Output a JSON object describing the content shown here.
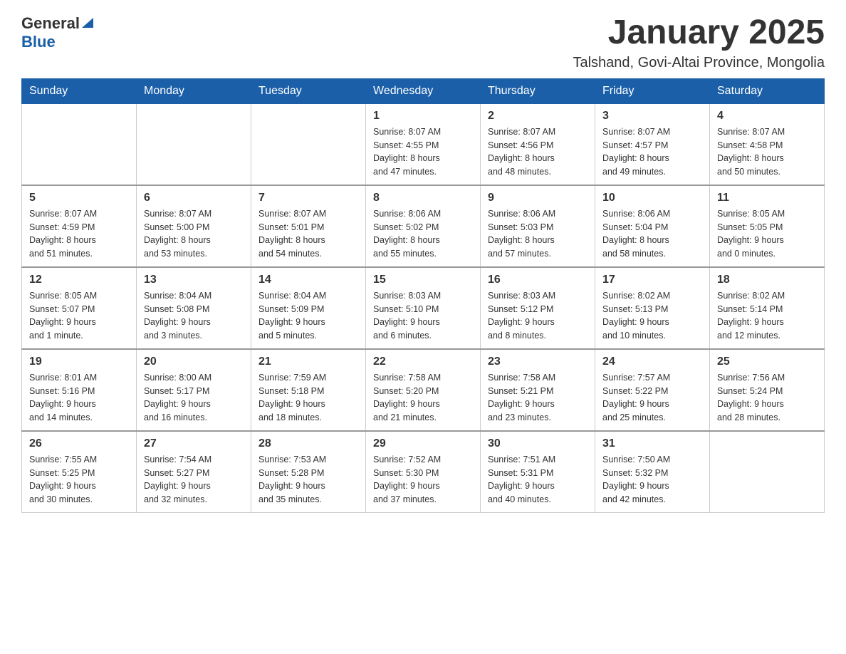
{
  "logo": {
    "general": "General",
    "blue": "Blue"
  },
  "header": {
    "title": "January 2025",
    "subtitle": "Talshand, Govi-Altai Province, Mongolia"
  },
  "days_of_week": [
    "Sunday",
    "Monday",
    "Tuesday",
    "Wednesday",
    "Thursday",
    "Friday",
    "Saturday"
  ],
  "weeks": [
    {
      "days": [
        {
          "num": "",
          "info": ""
        },
        {
          "num": "",
          "info": ""
        },
        {
          "num": "",
          "info": ""
        },
        {
          "num": "1",
          "info": "Sunrise: 8:07 AM\nSunset: 4:55 PM\nDaylight: 8 hours\nand 47 minutes."
        },
        {
          "num": "2",
          "info": "Sunrise: 8:07 AM\nSunset: 4:56 PM\nDaylight: 8 hours\nand 48 minutes."
        },
        {
          "num": "3",
          "info": "Sunrise: 8:07 AM\nSunset: 4:57 PM\nDaylight: 8 hours\nand 49 minutes."
        },
        {
          "num": "4",
          "info": "Sunrise: 8:07 AM\nSunset: 4:58 PM\nDaylight: 8 hours\nand 50 minutes."
        }
      ]
    },
    {
      "days": [
        {
          "num": "5",
          "info": "Sunrise: 8:07 AM\nSunset: 4:59 PM\nDaylight: 8 hours\nand 51 minutes."
        },
        {
          "num": "6",
          "info": "Sunrise: 8:07 AM\nSunset: 5:00 PM\nDaylight: 8 hours\nand 53 minutes."
        },
        {
          "num": "7",
          "info": "Sunrise: 8:07 AM\nSunset: 5:01 PM\nDaylight: 8 hours\nand 54 minutes."
        },
        {
          "num": "8",
          "info": "Sunrise: 8:06 AM\nSunset: 5:02 PM\nDaylight: 8 hours\nand 55 minutes."
        },
        {
          "num": "9",
          "info": "Sunrise: 8:06 AM\nSunset: 5:03 PM\nDaylight: 8 hours\nand 57 minutes."
        },
        {
          "num": "10",
          "info": "Sunrise: 8:06 AM\nSunset: 5:04 PM\nDaylight: 8 hours\nand 58 minutes."
        },
        {
          "num": "11",
          "info": "Sunrise: 8:05 AM\nSunset: 5:05 PM\nDaylight: 9 hours\nand 0 minutes."
        }
      ]
    },
    {
      "days": [
        {
          "num": "12",
          "info": "Sunrise: 8:05 AM\nSunset: 5:07 PM\nDaylight: 9 hours\nand 1 minute."
        },
        {
          "num": "13",
          "info": "Sunrise: 8:04 AM\nSunset: 5:08 PM\nDaylight: 9 hours\nand 3 minutes."
        },
        {
          "num": "14",
          "info": "Sunrise: 8:04 AM\nSunset: 5:09 PM\nDaylight: 9 hours\nand 5 minutes."
        },
        {
          "num": "15",
          "info": "Sunrise: 8:03 AM\nSunset: 5:10 PM\nDaylight: 9 hours\nand 6 minutes."
        },
        {
          "num": "16",
          "info": "Sunrise: 8:03 AM\nSunset: 5:12 PM\nDaylight: 9 hours\nand 8 minutes."
        },
        {
          "num": "17",
          "info": "Sunrise: 8:02 AM\nSunset: 5:13 PM\nDaylight: 9 hours\nand 10 minutes."
        },
        {
          "num": "18",
          "info": "Sunrise: 8:02 AM\nSunset: 5:14 PM\nDaylight: 9 hours\nand 12 minutes."
        }
      ]
    },
    {
      "days": [
        {
          "num": "19",
          "info": "Sunrise: 8:01 AM\nSunset: 5:16 PM\nDaylight: 9 hours\nand 14 minutes."
        },
        {
          "num": "20",
          "info": "Sunrise: 8:00 AM\nSunset: 5:17 PM\nDaylight: 9 hours\nand 16 minutes."
        },
        {
          "num": "21",
          "info": "Sunrise: 7:59 AM\nSunset: 5:18 PM\nDaylight: 9 hours\nand 18 minutes."
        },
        {
          "num": "22",
          "info": "Sunrise: 7:58 AM\nSunset: 5:20 PM\nDaylight: 9 hours\nand 21 minutes."
        },
        {
          "num": "23",
          "info": "Sunrise: 7:58 AM\nSunset: 5:21 PM\nDaylight: 9 hours\nand 23 minutes."
        },
        {
          "num": "24",
          "info": "Sunrise: 7:57 AM\nSunset: 5:22 PM\nDaylight: 9 hours\nand 25 minutes."
        },
        {
          "num": "25",
          "info": "Sunrise: 7:56 AM\nSunset: 5:24 PM\nDaylight: 9 hours\nand 28 minutes."
        }
      ]
    },
    {
      "days": [
        {
          "num": "26",
          "info": "Sunrise: 7:55 AM\nSunset: 5:25 PM\nDaylight: 9 hours\nand 30 minutes."
        },
        {
          "num": "27",
          "info": "Sunrise: 7:54 AM\nSunset: 5:27 PM\nDaylight: 9 hours\nand 32 minutes."
        },
        {
          "num": "28",
          "info": "Sunrise: 7:53 AM\nSunset: 5:28 PM\nDaylight: 9 hours\nand 35 minutes."
        },
        {
          "num": "29",
          "info": "Sunrise: 7:52 AM\nSunset: 5:30 PM\nDaylight: 9 hours\nand 37 minutes."
        },
        {
          "num": "30",
          "info": "Sunrise: 7:51 AM\nSunset: 5:31 PM\nDaylight: 9 hours\nand 40 minutes."
        },
        {
          "num": "31",
          "info": "Sunrise: 7:50 AM\nSunset: 5:32 PM\nDaylight: 9 hours\nand 42 minutes."
        },
        {
          "num": "",
          "info": ""
        }
      ]
    }
  ]
}
